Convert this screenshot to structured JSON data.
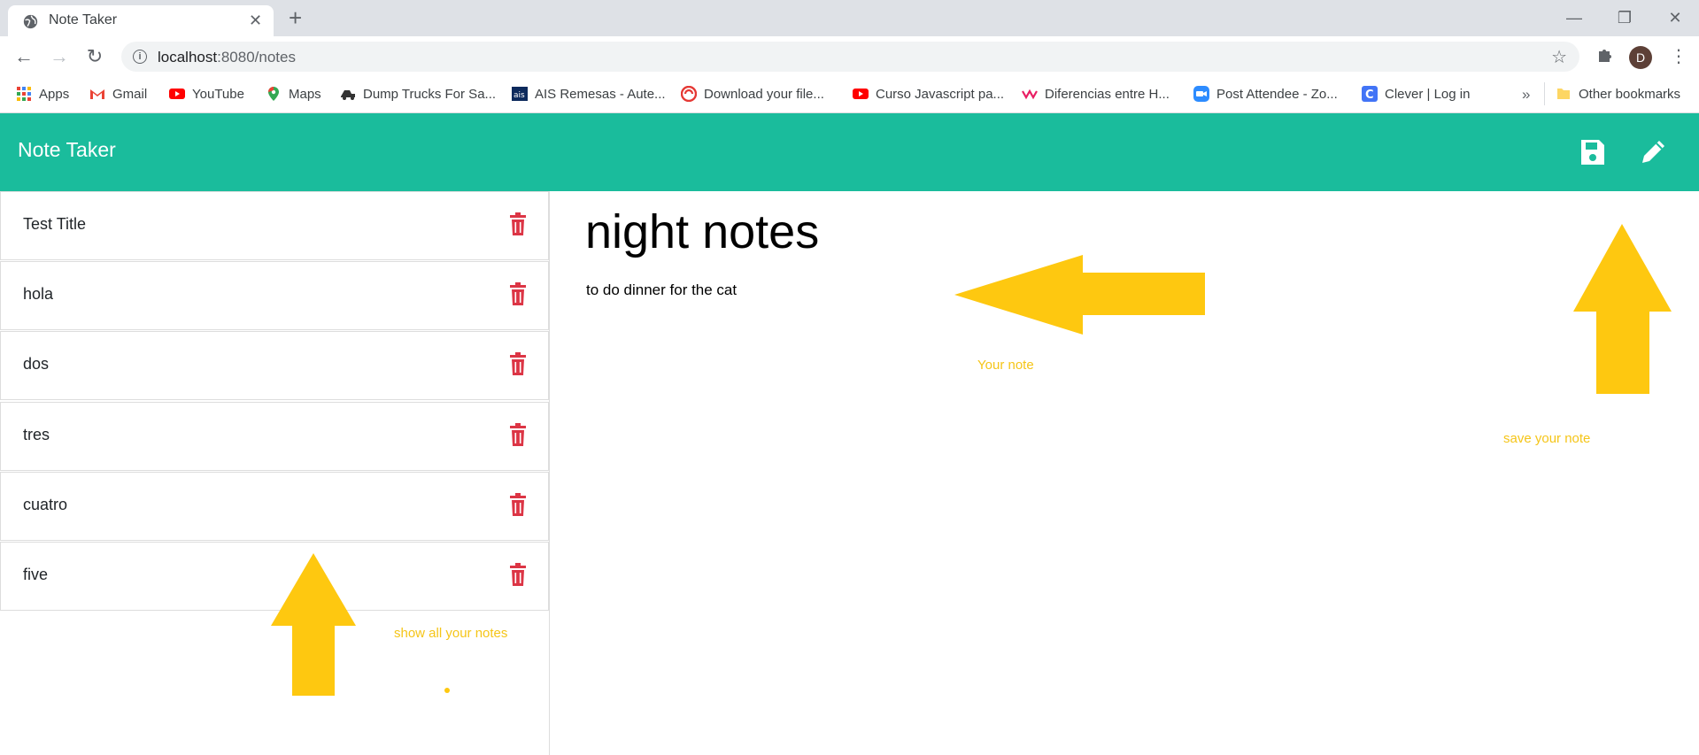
{
  "browser": {
    "tab_title": "Note Taker",
    "tab_close": "✕",
    "new_tab": "+",
    "url_host": "localhost",
    "url_path": ":8080/notes",
    "avatar_letter": "D",
    "window_controls": [
      "—",
      "❐",
      "✕"
    ],
    "bookmarks": [
      {
        "label": "Apps",
        "icon": "apps-grid-icon"
      },
      {
        "label": "Gmail",
        "icon": "gmail-icon"
      },
      {
        "label": "YouTube",
        "icon": "youtube-icon"
      },
      {
        "label": "Maps",
        "icon": "maps-icon"
      },
      {
        "label": "Dump Trucks For Sa...",
        "icon": "truck-icon"
      },
      {
        "label": "AIS Remesas - Aute...",
        "icon": "ais-icon"
      },
      {
        "label": "Download your file...",
        "icon": "download-icon"
      },
      {
        "label": "Curso Javascript pa...",
        "icon": "youtube-icon"
      },
      {
        "label": "Diferencias entre H...",
        "icon": "wave-icon"
      },
      {
        "label": "Post Attendee - Zo...",
        "icon": "zoom-icon"
      },
      {
        "label": "Clever | Log in",
        "icon": "clever-icon"
      }
    ],
    "bookmarks_overflow": "»",
    "other_bookmarks": "Other bookmarks"
  },
  "app": {
    "brand": "Note Taker",
    "notes": [
      {
        "title": "Test Title"
      },
      {
        "title": "hola"
      },
      {
        "title": "dos"
      },
      {
        "title": "tres"
      },
      {
        "title": "cuatro"
      },
      {
        "title": "five"
      }
    ],
    "active_note": {
      "title": "night notes",
      "text": "to do dinner for the cat"
    }
  },
  "annotations": {
    "your_note": "Your note",
    "save_your_note": "save your note",
    "show_all_notes": "show  all your notes"
  },
  "colors": {
    "navbar": "#1abc9c",
    "trash": "#dc3545",
    "annotation": "#f5c518"
  }
}
